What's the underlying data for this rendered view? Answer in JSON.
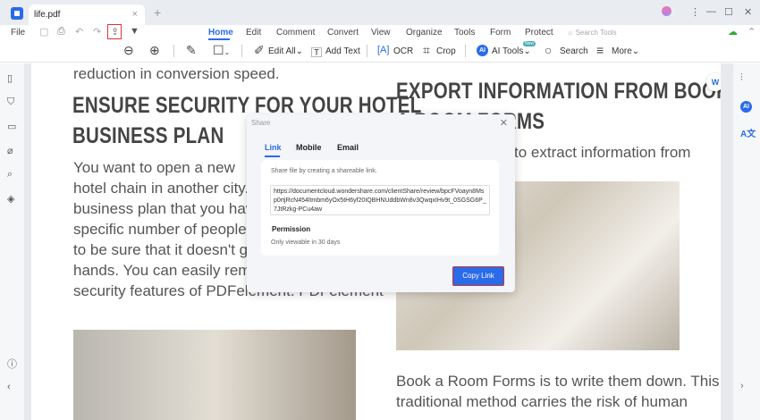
{
  "window": {
    "tab_title": "life.pdf",
    "close": "×",
    "new_tab": "+",
    "minimize": "—",
    "maximize": "☐",
    "close_window": "✕",
    "more": "⋮"
  },
  "menu": {
    "file": "File",
    "tabs": [
      "Home",
      "Edit",
      "Comment",
      "Convert",
      "View",
      "Organize",
      "Tools",
      "Form",
      "Protect"
    ],
    "search_tools": "Search Tools"
  },
  "toolbar": {
    "edit_all": "Edit All",
    "add_text": "Add Text",
    "ocr": "OCR",
    "crop": "Crop",
    "ai_tools": "AI Tools",
    "search": "Search",
    "more": "More",
    "new_badge": "New"
  },
  "document": {
    "left_top": "reduction in conversion speed.",
    "left_heading": [
      "ENSURE SECURITY FOR YOUR HOTEL",
      "BUSINESS PLAN"
    ],
    "left_body": [
      "You want to open a new",
      "hotel chain in another city.",
      "business plan that you hav",
      "specific number of people. H",
      "to be sure that it doesn't g",
      "hands. You can easily rem",
      "security features of PDFelement. PDFelement"
    ],
    "right_heading": [
      "EXPORT INFORMATION FROM BOOK",
      "A ROOM FORMS"
    ],
    "right_top": "to extract information from",
    "right_body": [
      "Book a Room Forms is to write them down. This",
      "traditional method carries the risk of human"
    ]
  },
  "share_dialog": {
    "title": "Share",
    "tabs": [
      "Link",
      "Mobile",
      "Email"
    ],
    "hint": "Share file by creating a shareable link.",
    "url": "https://documentcloud.wondershare.com/clientShare/review/bpcFVoayn8Msp0rtjRcN454ltmbm6yOx5tH6yf20IQBHNUddbWn8v3QwqxIHv9t_0SGSG6P_7JtRzkg-PCu4aw",
    "permission_label": "Permission",
    "permission_value": "Only viewable in 30 days",
    "copy_button": "Copy Link"
  },
  "colors": {
    "accent": "#2a6bea",
    "highlight": "#d33333"
  }
}
